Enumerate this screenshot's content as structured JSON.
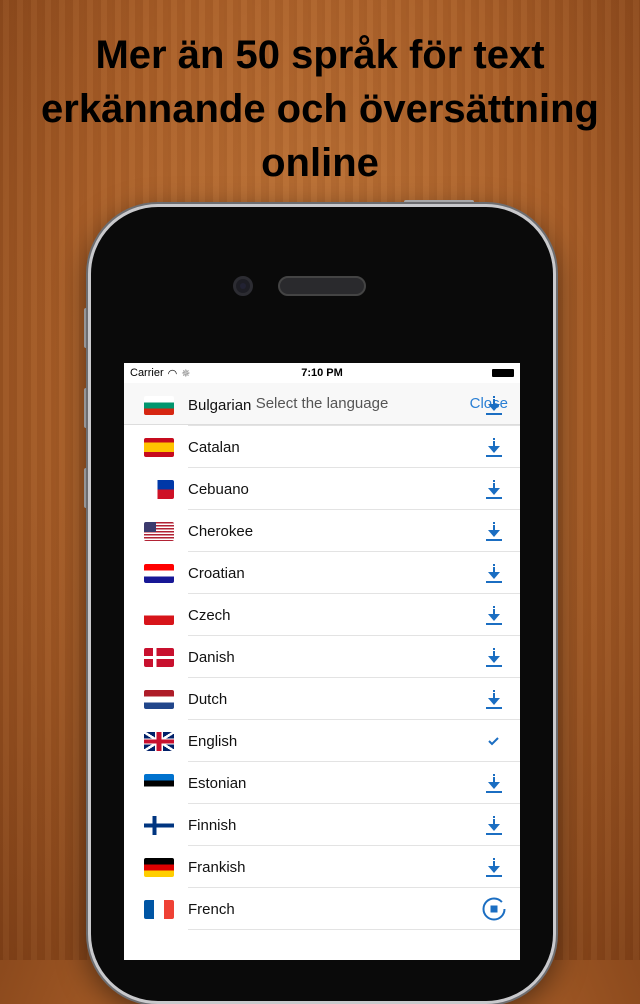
{
  "headline": "Mer än 50 språk för text erkännande och översättning online",
  "status": {
    "carrier": "Carrier",
    "time": "7:10 PM"
  },
  "nav": {
    "title": "Select the language",
    "close": "Close"
  },
  "accent": "#2a7fd4",
  "languages": [
    {
      "name": "Bulgarian",
      "flag": "bulgaria",
      "state": "download"
    },
    {
      "name": "Catalan",
      "flag": "spain",
      "state": "download"
    },
    {
      "name": "Cebuano",
      "flag": "philippines",
      "state": "download"
    },
    {
      "name": "Cherokee",
      "flag": "usa",
      "state": "download"
    },
    {
      "name": "Croatian",
      "flag": "croatia",
      "state": "download"
    },
    {
      "name": "Czech",
      "flag": "czech",
      "state": "download"
    },
    {
      "name": "Danish",
      "flag": "denmark",
      "state": "download"
    },
    {
      "name": "Dutch",
      "flag": "netherlands",
      "state": "download"
    },
    {
      "name": "English",
      "flag": "uk",
      "state": "installed"
    },
    {
      "name": "Estonian",
      "flag": "estonia",
      "state": "download"
    },
    {
      "name": "Finnish",
      "flag": "finland",
      "state": "download"
    },
    {
      "name": "Frankish",
      "flag": "germany",
      "state": "download"
    },
    {
      "name": "French",
      "flag": "france",
      "state": "downloading"
    }
  ]
}
